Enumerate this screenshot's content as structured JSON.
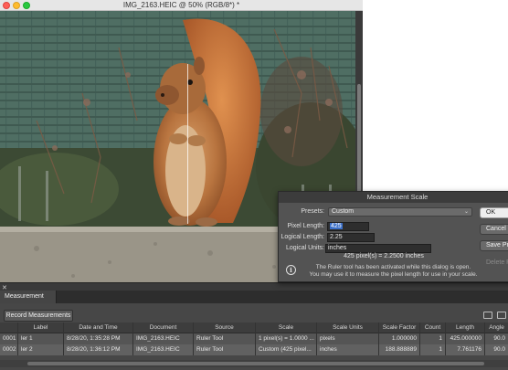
{
  "document": {
    "title": "IMG_2163.HEIC @ 50% (RGB/8*) *"
  },
  "dialog": {
    "title": "Measurement Scale",
    "presets_label": "Presets:",
    "presets_value": "Custom",
    "pixel_length_label": "Pixel Length:",
    "pixel_length_value": "425",
    "logical_length_label": "Logical Length:",
    "logical_length_value": "2.25",
    "logical_units_label": "Logical Units:",
    "logical_units_value": "inches",
    "summary": "425 pixel(s) = 2.2500 inches",
    "info_line1": "The Ruler tool has been activated while this dialog is open.",
    "info_line2": "You may use it to measure the pixel length for use in your scale.",
    "buttons": {
      "ok": "OK",
      "cancel": "Cancel",
      "save_preset": "Save Preset...",
      "delete_preset": "Delete Preset..."
    }
  },
  "panel": {
    "tab": "Measurement Log",
    "record_button": "Record Measurements",
    "columns": [
      "Label",
      "Date and Time",
      "Document",
      "Source",
      "Scale",
      "Scale Units",
      "Scale Factor",
      "Count",
      "Length",
      "Angle"
    ],
    "rows": [
      {
        "id": "0001",
        "label": "ler 1",
        "date": "8/28/20, 1:35:28 PM",
        "document": "IMG_2163.HEIC",
        "source": "Ruler Tool",
        "scale": "1 pixel(s) = 1.0000 ...",
        "units": "pixels",
        "factor": "1.000000",
        "count": "1",
        "length": "425.000000",
        "angle": "90.0"
      },
      {
        "id": "0002",
        "label": "ler 2",
        "date": "8/28/20, 1:36:12 PM",
        "document": "IMG_2163.HEIC",
        "source": "Ruler Tool",
        "scale": "Custom (425 pixel...",
        "units": "inches",
        "factor": "188.888889",
        "count": "1",
        "length": "7.761176",
        "angle": "90.0"
      }
    ]
  },
  "colors": {
    "accent": "#3b6fc7",
    "close": "#fe5f57",
    "minimize": "#febc2e",
    "maximize": "#28c840"
  },
  "icons": [
    "close-icon",
    "minimize-icon",
    "maximize-icon",
    "info-icon",
    "chevron-down-icon",
    "export-icon",
    "delete-icon"
  ]
}
